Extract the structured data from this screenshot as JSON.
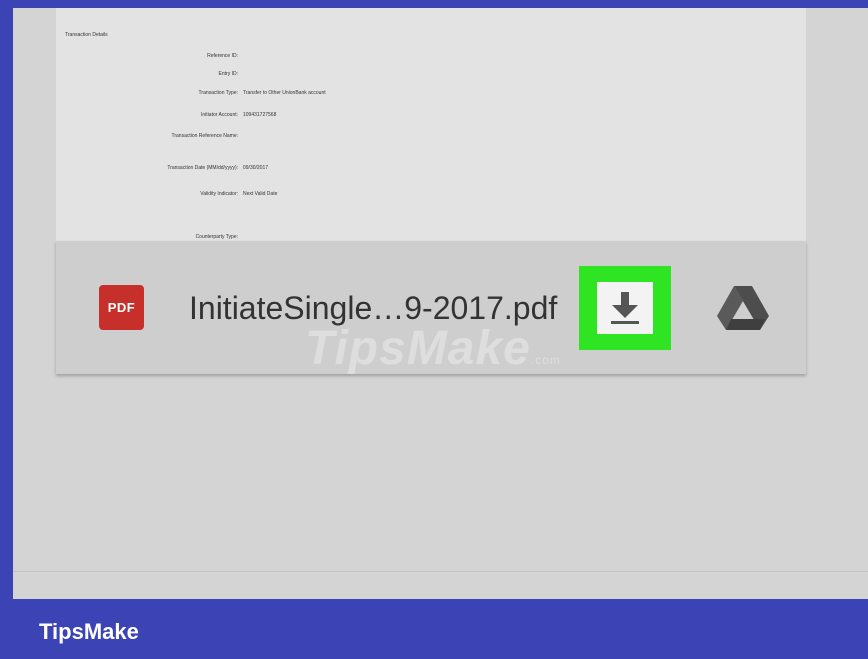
{
  "document": {
    "section_title": "Transaction Details",
    "fields": [
      {
        "label": "Reference ID:",
        "value": ""
      },
      {
        "label": "Entry ID:",
        "value": ""
      },
      {
        "label": "Transaction Type:",
        "value": "Transfer to Other UnionBank account"
      },
      {
        "label": "Initiator Account:",
        "value": "109431727568"
      },
      {
        "label": "Transaction Reference Name:",
        "value": ""
      },
      {
        "label": "Transaction Date (MM/dd/yyyy):",
        "value": "09/30/2017"
      },
      {
        "label": "Validity Indicator:",
        "value": "Next Valid Date"
      },
      {
        "label": "Counterparty Type:",
        "value": ""
      }
    ]
  },
  "download_bar": {
    "file_icon_text": "PDF",
    "file_name": "InitiateSingle…9-2017.pdf",
    "download_icon": "download-icon",
    "drive_icon": "google-drive-icon",
    "highlight_color": "#2fe423"
  },
  "watermark": {
    "text": "TipsMake",
    "suffix": ".com"
  },
  "footer": {
    "brand": "TipsMake"
  },
  "colors": {
    "brand_bar": "#3c43b5",
    "pdf_red": "#c7302a"
  }
}
